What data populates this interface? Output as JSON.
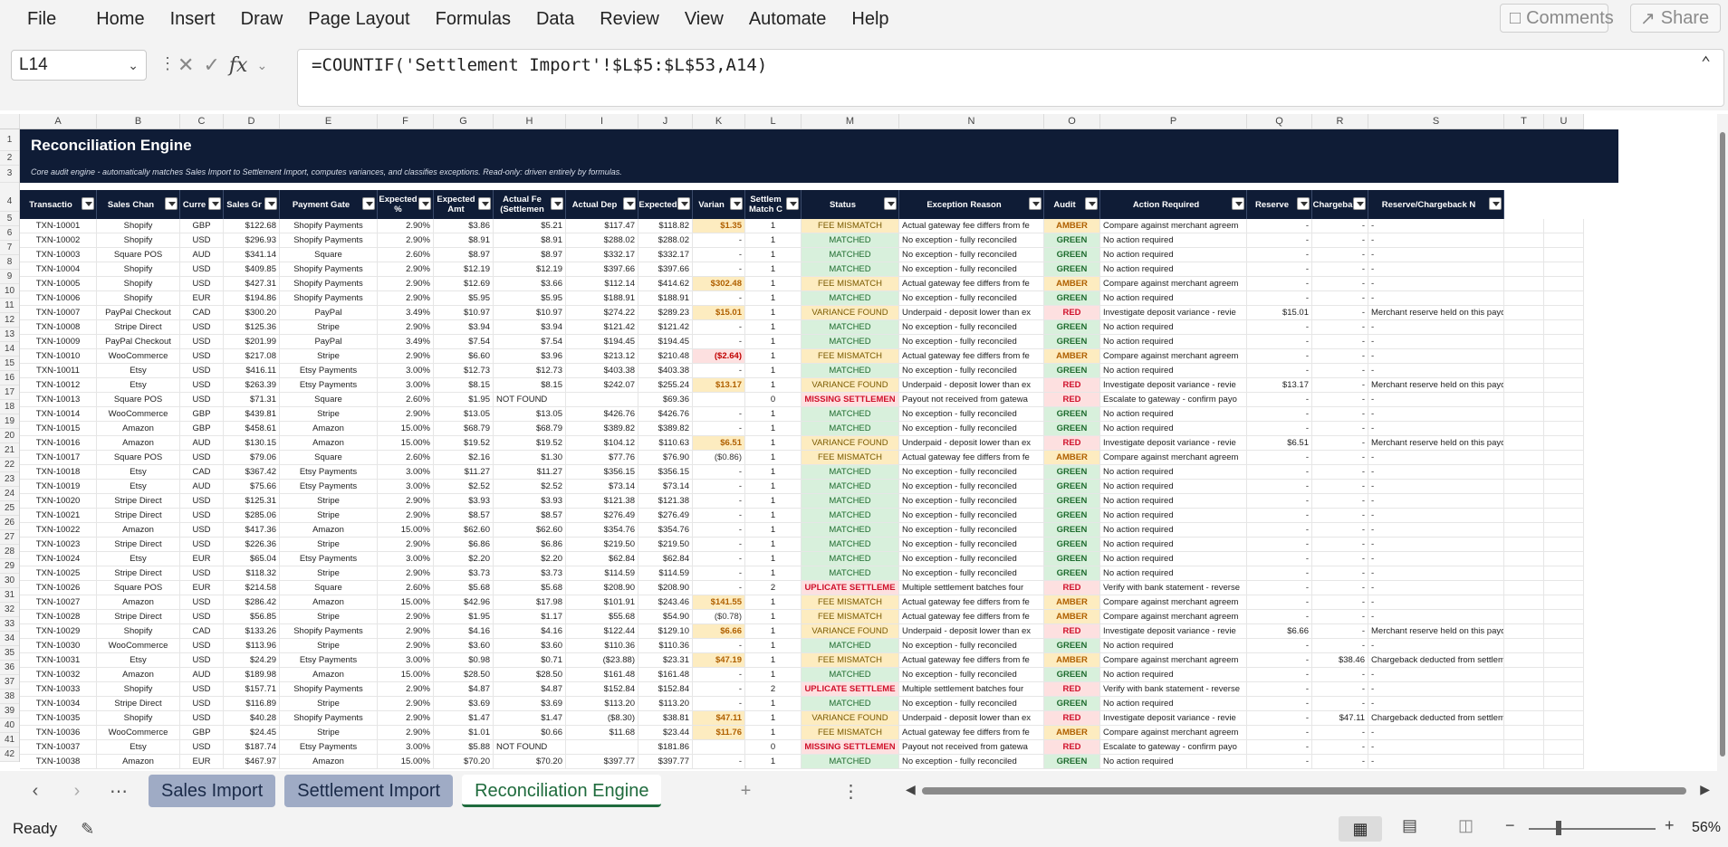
{
  "menu": [
    "File",
    "Home",
    "Insert",
    "Draw",
    "Page Layout",
    "Formulas",
    "Data",
    "Review",
    "View",
    "Automate",
    "Help"
  ],
  "top_buttons": {
    "comments": "Comments",
    "share": "Share"
  },
  "formula_bar": {
    "name_box": "L14",
    "formula": "=COUNTIF('Settlement Import'!$L$5:$L$53,A14)"
  },
  "columns": [
    "A",
    "B",
    "C",
    "D",
    "E",
    "F",
    "G",
    "H",
    "I",
    "J",
    "K",
    "L",
    "M",
    "N",
    "O",
    "P",
    "Q",
    "R",
    "S",
    "T",
    "U"
  ],
  "banner": {
    "title": "Reconciliation Engine",
    "subtitle": "Core audit engine - automatically matches Sales Import to Settlement Import, computes variances, and classifies exceptions. Read-only: driven entirely by formulas."
  },
  "headers": [
    "Transactio",
    "Sales Chan",
    "Curre",
    "Sales Gr",
    "Payment Gate",
    "Expected %",
    "Expected Amt",
    "Actual Fe (Settlemen",
    "Actual Dep",
    "Expected",
    "Varian",
    "Settlem Match C",
    "Status",
    "Exception Reason",
    "Audit",
    "Action Required",
    "Reserve",
    "Chargeba",
    "Reserve/Chargeback N"
  ],
  "row_numbers": [
    "1",
    "2",
    "3",
    "4",
    "5",
    "6",
    "7",
    "8",
    "9",
    "10",
    "11",
    "12",
    "13",
    "14",
    "15",
    "16",
    "17",
    "18",
    "19",
    "20",
    "21",
    "22",
    "23",
    "24",
    "25",
    "26",
    "27",
    "28",
    "29",
    "30",
    "31",
    "32",
    "33",
    "34",
    "35",
    "36",
    "37",
    "38",
    "39",
    "40",
    "41",
    "42"
  ],
  "rows": [
    [
      "TXN-10001",
      "Shopify",
      "GBP",
      "$122.68",
      "Shopify Payments",
      "2.90%",
      "$3.86",
      "$5.21",
      "$117.47",
      "$118.82",
      "$1.35",
      "1",
      "FEE MISMATCH",
      "Actual gateway fee differs from fe",
      "AMBER",
      "Compare against merchant agreem",
      "-",
      "-",
      "-"
    ],
    [
      "TXN-10002",
      "Shopify",
      "USD",
      "$296.93",
      "Shopify Payments",
      "2.90%",
      "$8.91",
      "$8.91",
      "$288.02",
      "$288.02",
      "-",
      "1",
      "MATCHED",
      "No exception - fully reconciled",
      "GREEN",
      "No action required",
      "-",
      "-",
      "-"
    ],
    [
      "TXN-10003",
      "Square POS",
      "AUD",
      "$341.14",
      "Square",
      "2.60%",
      "$8.97",
      "$8.97",
      "$332.17",
      "$332.17",
      "-",
      "1",
      "MATCHED",
      "No exception - fully reconciled",
      "GREEN",
      "No action required",
      "-",
      "-",
      "-"
    ],
    [
      "TXN-10004",
      "Shopify",
      "USD",
      "$409.85",
      "Shopify Payments",
      "2.90%",
      "$12.19",
      "$12.19",
      "$397.66",
      "$397.66",
      "-",
      "1",
      "MATCHED",
      "No exception - fully reconciled",
      "GREEN",
      "No action required",
      "-",
      "-",
      "-"
    ],
    [
      "TXN-10005",
      "Shopify",
      "USD",
      "$427.31",
      "Shopify Payments",
      "2.90%",
      "$12.69",
      "$3.66",
      "$112.14",
      "$414.62",
      "$302.48",
      "1",
      "FEE MISMATCH",
      "Actual gateway fee differs from fe",
      "AMBER",
      "Compare against merchant agreem",
      "-",
      "-",
      "-"
    ],
    [
      "TXN-10006",
      "Shopify",
      "EUR",
      "$194.86",
      "Shopify Payments",
      "2.90%",
      "$5.95",
      "$5.95",
      "$188.91",
      "$188.91",
      "-",
      "1",
      "MATCHED",
      "No exception - fully reconciled",
      "GREEN",
      "No action required",
      "-",
      "-",
      "-"
    ],
    [
      "TXN-10007",
      "PayPal Checkout",
      "CAD",
      "$300.20",
      "PayPal",
      "3.49%",
      "$10.97",
      "$10.97",
      "$274.22",
      "$289.23",
      "$15.01",
      "1",
      "VARIANCE FOUND",
      "Underpaid - deposit lower than ex",
      "RED",
      "Investigate deposit variance - revie",
      "$15.01",
      "-",
      "Merchant reserve held on this payout"
    ],
    [
      "TXN-10008",
      "Stripe Direct",
      "USD",
      "$125.36",
      "Stripe",
      "2.90%",
      "$3.94",
      "$3.94",
      "$121.42",
      "$121.42",
      "-",
      "1",
      "MATCHED",
      "No exception - fully reconciled",
      "GREEN",
      "No action required",
      "-",
      "-",
      "-"
    ],
    [
      "TXN-10009",
      "PayPal Checkout",
      "USD",
      "$201.99",
      "PayPal",
      "3.49%",
      "$7.54",
      "$7.54",
      "$194.45",
      "$194.45",
      "-",
      "1",
      "MATCHED",
      "No exception - fully reconciled",
      "GREEN",
      "No action required",
      "-",
      "-",
      "-"
    ],
    [
      "TXN-10010",
      "WooCommerce",
      "USD",
      "$217.08",
      "Stripe",
      "2.90%",
      "$6.60",
      "$3.96",
      "$213.12",
      "$210.48",
      "($2.64)",
      "1",
      "FEE MISMATCH",
      "Actual gateway fee differs from fe",
      "AMBER",
      "Compare against merchant agreem",
      "-",
      "-",
      "-"
    ],
    [
      "TXN-10011",
      "Etsy",
      "USD",
      "$416.11",
      "Etsy Payments",
      "3.00%",
      "$12.73",
      "$12.73",
      "$403.38",
      "$403.38",
      "-",
      "1",
      "MATCHED",
      "No exception - fully reconciled",
      "GREEN",
      "No action required",
      "-",
      "-",
      "-"
    ],
    [
      "TXN-10012",
      "Etsy",
      "USD",
      "$263.39",
      "Etsy Payments",
      "3.00%",
      "$8.15",
      "$8.15",
      "$242.07",
      "$255.24",
      "$13.17",
      "1",
      "VARIANCE FOUND",
      "Underpaid - deposit lower than ex",
      "RED",
      "Investigate deposit variance - revie",
      "$13.17",
      "-",
      "Merchant reserve held on this payout"
    ],
    [
      "TXN-10013",
      "Square POS",
      "USD",
      "$71.31",
      "Square",
      "2.60%",
      "$1.95",
      "NOT FOUND",
      "",
      "$69.36",
      "",
      "0",
      "MISSING SETTLEMEN",
      "Payout not received from gatewa",
      "RED",
      "Escalate to gateway - confirm payo",
      "-",
      "-",
      "-"
    ],
    [
      "TXN-10014",
      "WooCommerce",
      "GBP",
      "$439.81",
      "Stripe",
      "2.90%",
      "$13.05",
      "$13.05",
      "$426.76",
      "$426.76",
      "-",
      "1",
      "MATCHED",
      "No exception - fully reconciled",
      "GREEN",
      "No action required",
      "-",
      "-",
      "-"
    ],
    [
      "TXN-10015",
      "Amazon",
      "GBP",
      "$458.61",
      "Amazon",
      "15.00%",
      "$68.79",
      "$68.79",
      "$389.82",
      "$389.82",
      "-",
      "1",
      "MATCHED",
      "No exception - fully reconciled",
      "GREEN",
      "No action required",
      "-",
      "-",
      "-"
    ],
    [
      "TXN-10016",
      "Amazon",
      "AUD",
      "$130.15",
      "Amazon",
      "15.00%",
      "$19.52",
      "$19.52",
      "$104.12",
      "$110.63",
      "$6.51",
      "1",
      "VARIANCE FOUND",
      "Underpaid - deposit lower than ex",
      "RED",
      "Investigate deposit variance - revie",
      "$6.51",
      "-",
      "Merchant reserve held on this payout"
    ],
    [
      "TXN-10017",
      "Square POS",
      "USD",
      "$79.06",
      "Square",
      "2.60%",
      "$2.16",
      "$1.30",
      "$77.76",
      "$76.90",
      "($0.86)",
      "1",
      "FEE MISMATCH",
      "Actual gateway fee differs from fe",
      "AMBER",
      "Compare against merchant agreem",
      "-",
      "-",
      "-"
    ],
    [
      "TXN-10018",
      "Etsy",
      "CAD",
      "$367.42",
      "Etsy Payments",
      "3.00%",
      "$11.27",
      "$11.27",
      "$356.15",
      "$356.15",
      "-",
      "1",
      "MATCHED",
      "No exception - fully reconciled",
      "GREEN",
      "No action required",
      "-",
      "-",
      "-"
    ],
    [
      "TXN-10019",
      "Etsy",
      "AUD",
      "$75.66",
      "Etsy Payments",
      "3.00%",
      "$2.52",
      "$2.52",
      "$73.14",
      "$73.14",
      "-",
      "1",
      "MATCHED",
      "No exception - fully reconciled",
      "GREEN",
      "No action required",
      "-",
      "-",
      "-"
    ],
    [
      "TXN-10020",
      "Stripe Direct",
      "USD",
      "$125.31",
      "Stripe",
      "2.90%",
      "$3.93",
      "$3.93",
      "$121.38",
      "$121.38",
      "-",
      "1",
      "MATCHED",
      "No exception - fully reconciled",
      "GREEN",
      "No action required",
      "-",
      "-",
      "-"
    ],
    [
      "TXN-10021",
      "Stripe Direct",
      "USD",
      "$285.06",
      "Stripe",
      "2.90%",
      "$8.57",
      "$8.57",
      "$276.49",
      "$276.49",
      "-",
      "1",
      "MATCHED",
      "No exception - fully reconciled",
      "GREEN",
      "No action required",
      "-",
      "-",
      "-"
    ],
    [
      "TXN-10022",
      "Amazon",
      "USD",
      "$417.36",
      "Amazon",
      "15.00%",
      "$62.60",
      "$62.60",
      "$354.76",
      "$354.76",
      "-",
      "1",
      "MATCHED",
      "No exception - fully reconciled",
      "GREEN",
      "No action required",
      "-",
      "-",
      "-"
    ],
    [
      "TXN-10023",
      "Stripe Direct",
      "USD",
      "$226.36",
      "Stripe",
      "2.90%",
      "$6.86",
      "$6.86",
      "$219.50",
      "$219.50",
      "-",
      "1",
      "MATCHED",
      "No exception - fully reconciled",
      "GREEN",
      "No action required",
      "-",
      "-",
      "-"
    ],
    [
      "TXN-10024",
      "Etsy",
      "EUR",
      "$65.04",
      "Etsy Payments",
      "3.00%",
      "$2.20",
      "$2.20",
      "$62.84",
      "$62.84",
      "-",
      "1",
      "MATCHED",
      "No exception - fully reconciled",
      "GREEN",
      "No action required",
      "-",
      "-",
      "-"
    ],
    [
      "TXN-10025",
      "Stripe Direct",
      "USD",
      "$118.32",
      "Stripe",
      "2.90%",
      "$3.73",
      "$3.73",
      "$114.59",
      "$114.59",
      "-",
      "1",
      "MATCHED",
      "No exception - fully reconciled",
      "GREEN",
      "No action required",
      "-",
      "-",
      "-"
    ],
    [
      "TXN-10026",
      "Square POS",
      "EUR",
      "$214.58",
      "Square",
      "2.60%",
      "$5.68",
      "$5.68",
      "$208.90",
      "$208.90",
      "-",
      "2",
      "UPLICATE SETTLEME",
      "Multiple settlement batches four",
      "RED",
      "Verify with bank statement - reverse",
      "-",
      "-",
      "-"
    ],
    [
      "TXN-10027",
      "Amazon",
      "USD",
      "$286.42",
      "Amazon",
      "15.00%",
      "$42.96",
      "$17.98",
      "$101.91",
      "$243.46",
      "$141.55",
      "1",
      "FEE MISMATCH",
      "Actual gateway fee differs from fe",
      "AMBER",
      "Compare against merchant agreem",
      "-",
      "-",
      "-"
    ],
    [
      "TXN-10028",
      "Stripe Direct",
      "USD",
      "$56.85",
      "Stripe",
      "2.90%",
      "$1.95",
      "$1.17",
      "$55.68",
      "$54.90",
      "($0.78)",
      "1",
      "FEE MISMATCH",
      "Actual gateway fee differs from fe",
      "AMBER",
      "Compare against merchant agreem",
      "-",
      "-",
      "-"
    ],
    [
      "TXN-10029",
      "Shopify",
      "CAD",
      "$133.26",
      "Shopify Payments",
      "2.90%",
      "$4.16",
      "$4.16",
      "$122.44",
      "$129.10",
      "$6.66",
      "1",
      "VARIANCE FOUND",
      "Underpaid - deposit lower than ex",
      "RED",
      "Investigate deposit variance - revie",
      "$6.66",
      "-",
      "Merchant reserve held on this payout"
    ],
    [
      "TXN-10030",
      "WooCommerce",
      "USD",
      "$113.96",
      "Stripe",
      "2.90%",
      "$3.60",
      "$3.60",
      "$110.36",
      "$110.36",
      "-",
      "1",
      "MATCHED",
      "No exception - fully reconciled",
      "GREEN",
      "No action required",
      "-",
      "-",
      "-"
    ],
    [
      "TXN-10031",
      "Etsy",
      "USD",
      "$24.29",
      "Etsy Payments",
      "3.00%",
      "$0.98",
      "$0.71",
      "($23.88)",
      "$23.31",
      "$47.19",
      "1",
      "FEE MISMATCH",
      "Actual gateway fee differs from fe",
      "AMBER",
      "Compare against merchant agreem",
      "-",
      "$38.46",
      "Chargeback deducted from settlement"
    ],
    [
      "TXN-10032",
      "Amazon",
      "AUD",
      "$189.98",
      "Amazon",
      "15.00%",
      "$28.50",
      "$28.50",
      "$161.48",
      "$161.48",
      "-",
      "1",
      "MATCHED",
      "No exception - fully reconciled",
      "GREEN",
      "No action required",
      "-",
      "-",
      "-"
    ],
    [
      "TXN-10033",
      "Shopify",
      "USD",
      "$157.71",
      "Shopify Payments",
      "2.90%",
      "$4.87",
      "$4.87",
      "$152.84",
      "$152.84",
      "-",
      "2",
      "UPLICATE SETTLEME",
      "Multiple settlement batches four",
      "RED",
      "Verify with bank statement - reverse",
      "-",
      "-",
      "-"
    ],
    [
      "TXN-10034",
      "Stripe Direct",
      "USD",
      "$116.89",
      "Stripe",
      "2.90%",
      "$3.69",
      "$3.69",
      "$113.20",
      "$113.20",
      "-",
      "1",
      "MATCHED",
      "No exception - fully reconciled",
      "GREEN",
      "No action required",
      "-",
      "-",
      "-"
    ],
    [
      "TXN-10035",
      "Shopify",
      "USD",
      "$40.28",
      "Shopify Payments",
      "2.90%",
      "$1.47",
      "$1.47",
      "($8.30)",
      "$38.81",
      "$47.11",
      "1",
      "VARIANCE FOUND",
      "Underpaid - deposit lower than ex",
      "RED",
      "Investigate deposit variance - revie",
      "-",
      "$47.11",
      "Chargeback deducted from settlement"
    ],
    [
      "TXN-10036",
      "WooCommerce",
      "GBP",
      "$24.45",
      "Stripe",
      "2.90%",
      "$1.01",
      "$0.66",
      "$11.68",
      "$23.44",
      "$11.76",
      "1",
      "FEE MISMATCH",
      "Actual gateway fee differs from fe",
      "AMBER",
      "Compare against merchant agreem",
      "-",
      "-",
      "-"
    ],
    [
      "TXN-10037",
      "Etsy",
      "USD",
      "$187.74",
      "Etsy Payments",
      "3.00%",
      "$5.88",
      "NOT FOUND",
      "",
      "$181.86",
      "",
      "0",
      "MISSING SETTLEMEN",
      "Payout not received from gatewa",
      "RED",
      "Escalate to gateway - confirm payo",
      "-",
      "-",
      "-"
    ],
    [
      "TXN-10038",
      "Amazon",
      "EUR",
      "$467.97",
      "Amazon",
      "15.00%",
      "$70.20",
      "$70.20",
      "$397.77",
      "$397.77",
      "-",
      "1",
      "MATCHED",
      "No exception - fully reconciled",
      "GREEN",
      "No action required",
      "-",
      "-",
      "-"
    ]
  ],
  "sheet_tabs": [
    "Sales Import",
    "Settlement Import",
    "Reconciliation Engine"
  ],
  "active_tab": "Reconciliation Engine",
  "status": {
    "ready": "Ready",
    "zoom": "56%"
  },
  "colors": {
    "banner": "#0f1c36",
    "active_tab": "#1f6b3d"
  }
}
